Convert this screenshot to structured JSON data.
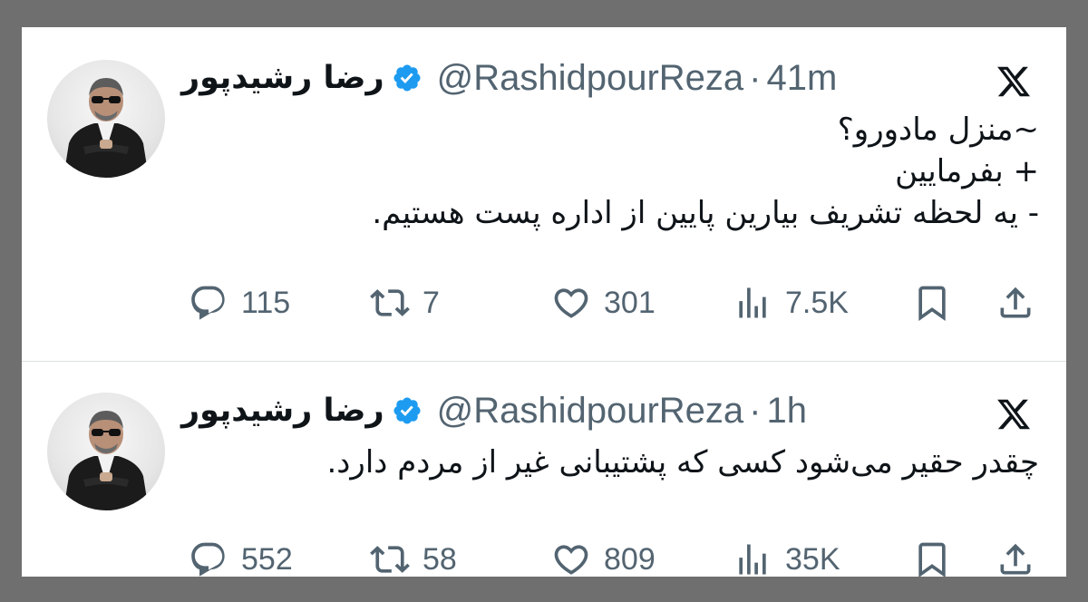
{
  "tweets": [
    {
      "display_name": "رضا رشیدپور",
      "handle": "@RashidpourReza",
      "separator": "·",
      "time": "41m",
      "lines": [
        "~منزل مادورو؟",
        "+ بفرمایین",
        "- یه لحظه تشریف بیارین پایین از اداره پست هستیم."
      ],
      "replies": "115",
      "retweets": "7",
      "likes": "301",
      "views": "7.5K"
    },
    {
      "display_name": "رضا رشیدپور",
      "handle": "@RashidpourReza",
      "separator": "·",
      "time": "1h",
      "lines": [
        "چقدر حقیر می‌شود کسی که پشتیبانی غیر از مردم دارد."
      ],
      "replies": "552",
      "retweets": "58",
      "likes": "809",
      "views": "35K"
    }
  ],
  "icons": {
    "verified": "verified-badge-icon",
    "platform": "x-logo-icon",
    "reply": "reply-icon",
    "retweet": "retweet-icon",
    "like": "heart-icon",
    "views": "views-icon",
    "bookmark": "bookmark-icon",
    "share": "share-icon"
  },
  "colors": {
    "verified_blue": "#1d9bf0",
    "text": "#0f1419",
    "secondary": "#536471",
    "frame": "#6f6f6f"
  }
}
